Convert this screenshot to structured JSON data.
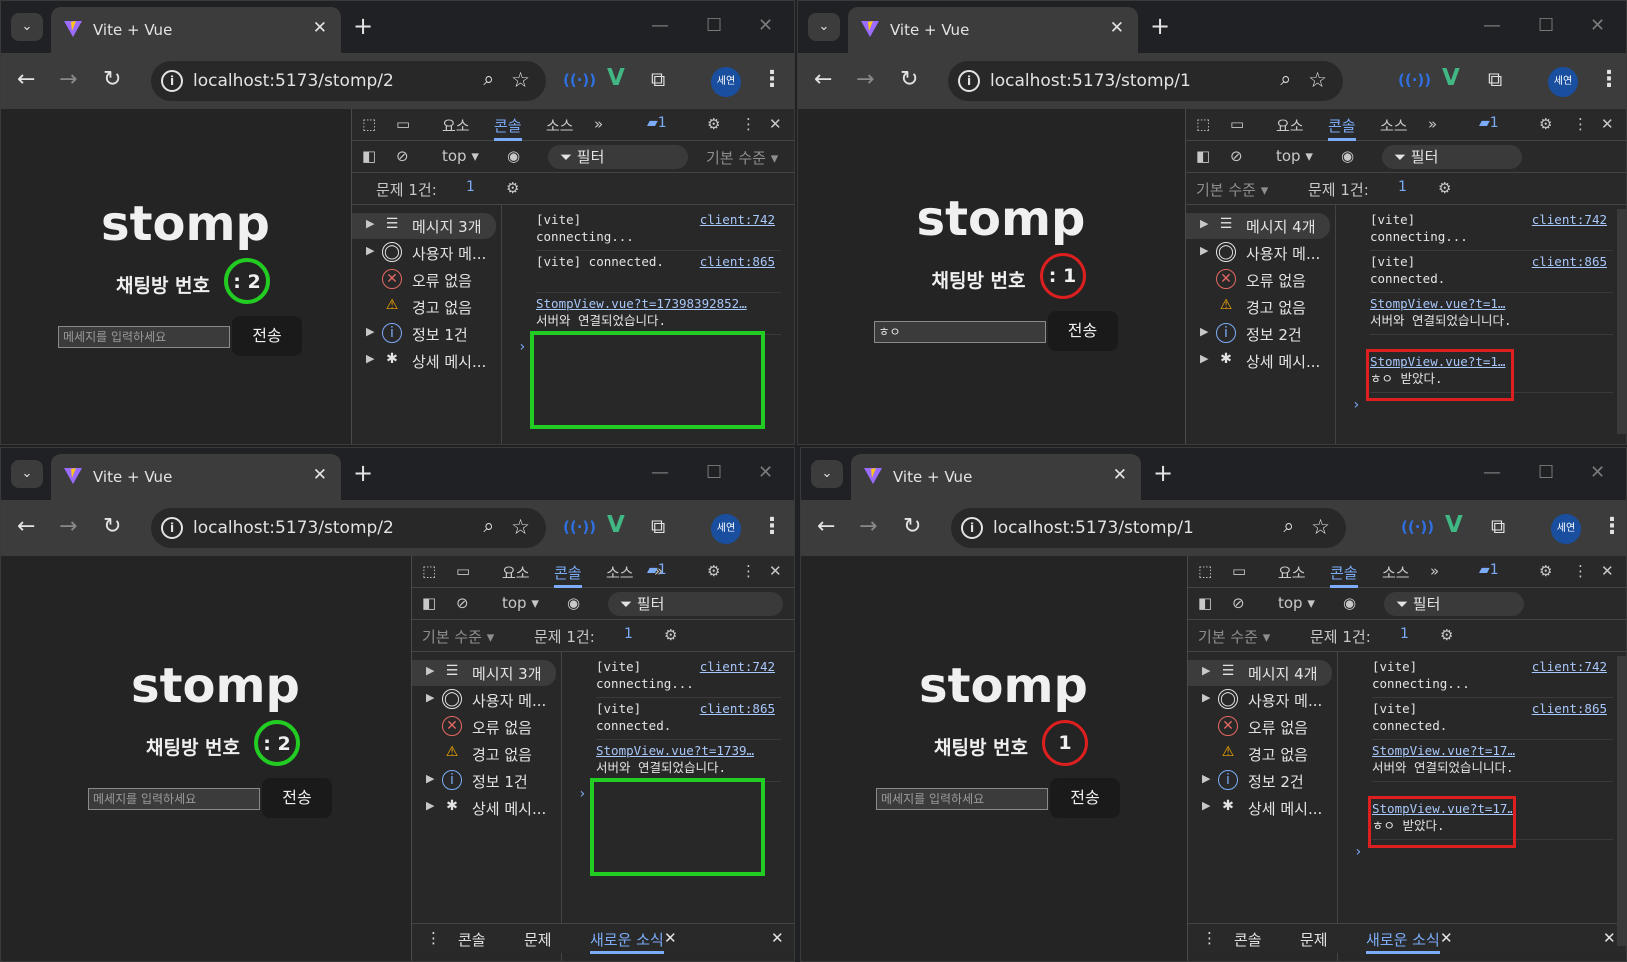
{
  "common": {
    "tab_title": "Vite + Vue",
    "new_tab": "+",
    "profile": "세연",
    "app_title": "stomp",
    "room_label": "채팅방 번호",
    "send_label": "전송",
    "input_placeholder": "메세지를 입력하세요",
    "dev_tabs": [
      "요소",
      "콘솔",
      "소스"
    ],
    "top_context": "top ▾",
    "filter_label": "필터",
    "levels_label": "기본 수준 ▾",
    "issues_label": "문제 1건:",
    "drawer_tabs": [
      "콘솔",
      "문제",
      "새로운 소식"
    ]
  },
  "windows": [
    {
      "url": "localhost:5173/stomp/2",
      "room_number": ": 2",
      "input_value": "",
      "highlight": "green",
      "issues_count": "1",
      "sidebar": [
        "메시지 3개",
        "사용자 메...",
        "오류 없음",
        "경고 없음",
        "정보 1건",
        "상세 메시...",
        ""
      ],
      "console": [
        {
          "text1": "[vite]",
          "text2": "connecting...",
          "link": "client:742"
        },
        {
          "text1": "[vite] connected.",
          "text2": "",
          "link": "client:865"
        },
        {
          "text1": "StompView.vue?t=17398392852…",
          "text2": "서버와 연결되었습니다.",
          "link": ""
        }
      ]
    },
    {
      "url": "localhost:5173/stomp/1",
      "room_number": ": 1",
      "input_value": "ㅎㅇ",
      "highlight": "red",
      "issues_count": "1",
      "sidebar": [
        "메시지 4개",
        "사용자 메...",
        "오류 없음",
        "경고 없음",
        "정보 2건",
        "상세 메시...",
        ""
      ],
      "console": [
        {
          "text1": "[vite]",
          "text2": "connecting...",
          "link": "client:742"
        },
        {
          "text1": "[vite]",
          "text2": "connected.",
          "link": "client:865"
        },
        {
          "text1": "StompView.vue?t=1…",
          "text2": "서버와 연결되었습니니다.",
          "link": ""
        },
        {
          "text1": "StompView.vue?t=1…",
          "text2": "ㅎㅇ 받았다.",
          "link": ""
        }
      ]
    },
    {
      "url": "localhost:5173/stomp/2",
      "room_number": ": 2",
      "input_value": "",
      "highlight": "green",
      "issues_count": "1",
      "sidebar": [
        "메시지 3개",
        "사용자 메...",
        "오류 없음",
        "경고 없음",
        "정보 1건",
        "상세 메시..."
      ],
      "console": [
        {
          "text1": "[vite]",
          "text2": "connecting...",
          "link": "client:742"
        },
        {
          "text1": "[vite]",
          "text2": "connected.",
          "link": "client:865"
        },
        {
          "text1": "StompView.vue?t=1739…",
          "text2": "서버와 연결되었습니다.",
          "link": ""
        }
      ]
    },
    {
      "url": "localhost:5173/stomp/1",
      "room_number": "1",
      "input_value": "",
      "highlight": "red",
      "issues_count": "1",
      "sidebar": [
        "메시지 4개",
        "사용자 메...",
        "오류 없음",
        "경고 없음",
        "정보 2건",
        "상세 메시..."
      ],
      "console": [
        {
          "text1": "[vite]",
          "text2": "connecting...",
          "link": "client:742"
        },
        {
          "text1": "[vite]",
          "text2": "connected.",
          "link": "client:865"
        },
        {
          "text1": "StompView.vue?t=17…",
          "text2": "서버와 연결되었습니니다.",
          "link": ""
        },
        {
          "text1": "StompView.vue?t=17…",
          "text2": "ㅎㅇ 받았다.",
          "link": ""
        }
      ]
    }
  ]
}
